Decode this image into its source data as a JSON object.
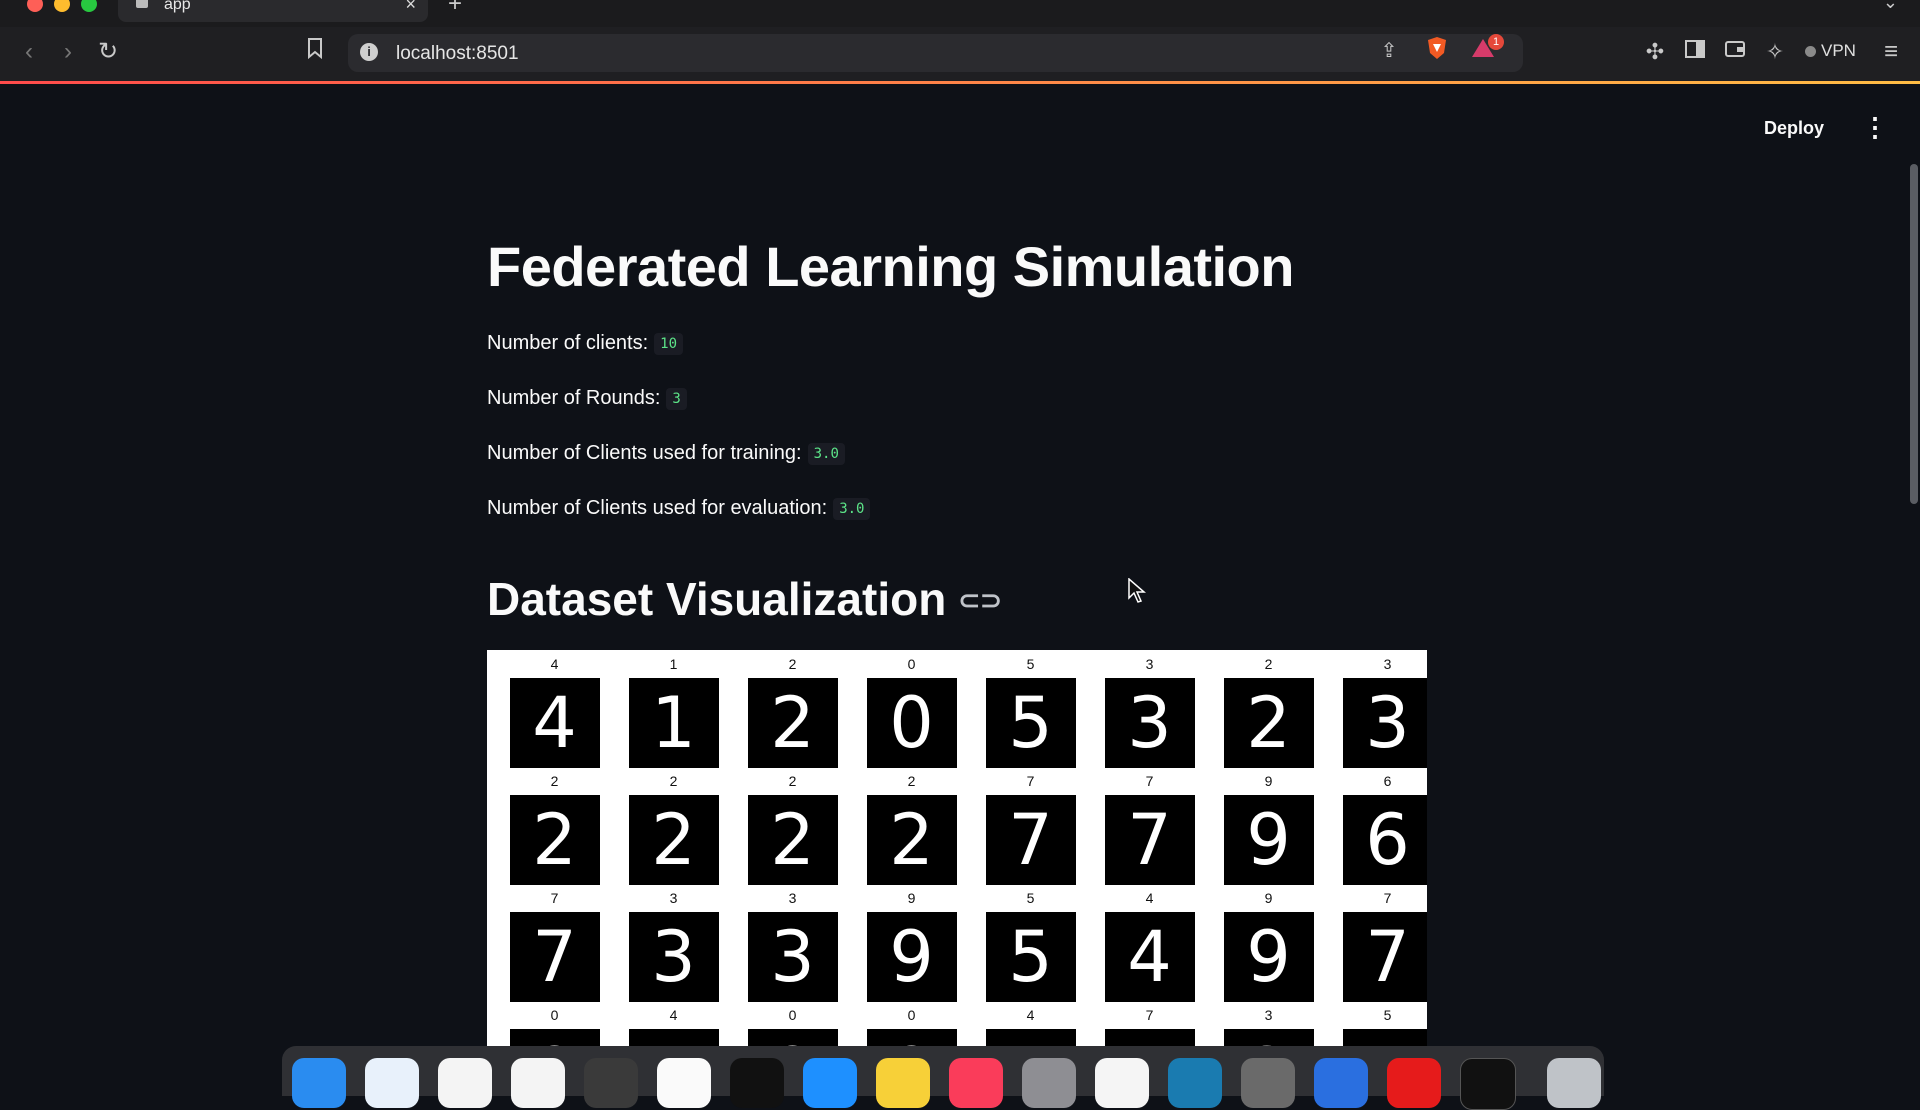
{
  "browser": {
    "tab_title": "app",
    "url": "localhost:8501",
    "vpn_label": "VPN",
    "notification_count": "1"
  },
  "app": {
    "deploy_label": "Deploy",
    "title": "Federated Learning Simulation",
    "params": [
      {
        "label": "Number of clients:",
        "value": "10"
      },
      {
        "label": "Number of Rounds:",
        "value": "3"
      },
      {
        "label": "Number of Clients used for training:",
        "value": "3.0"
      },
      {
        "label": "Number of Clients used for evaluation:",
        "value": "3.0"
      }
    ],
    "dataset_heading": "Dataset Visualization",
    "digit_labels": [
      [
        "4",
        "1",
        "2",
        "0",
        "5",
        "3",
        "2",
        "3"
      ],
      [
        "2",
        "2",
        "2",
        "2",
        "7",
        "7",
        "9",
        "6"
      ],
      [
        "7",
        "3",
        "3",
        "9",
        "5",
        "4",
        "9",
        "7"
      ],
      [
        "0",
        "4",
        "0",
        "0",
        "4",
        "7",
        "3",
        "5"
      ]
    ]
  }
}
